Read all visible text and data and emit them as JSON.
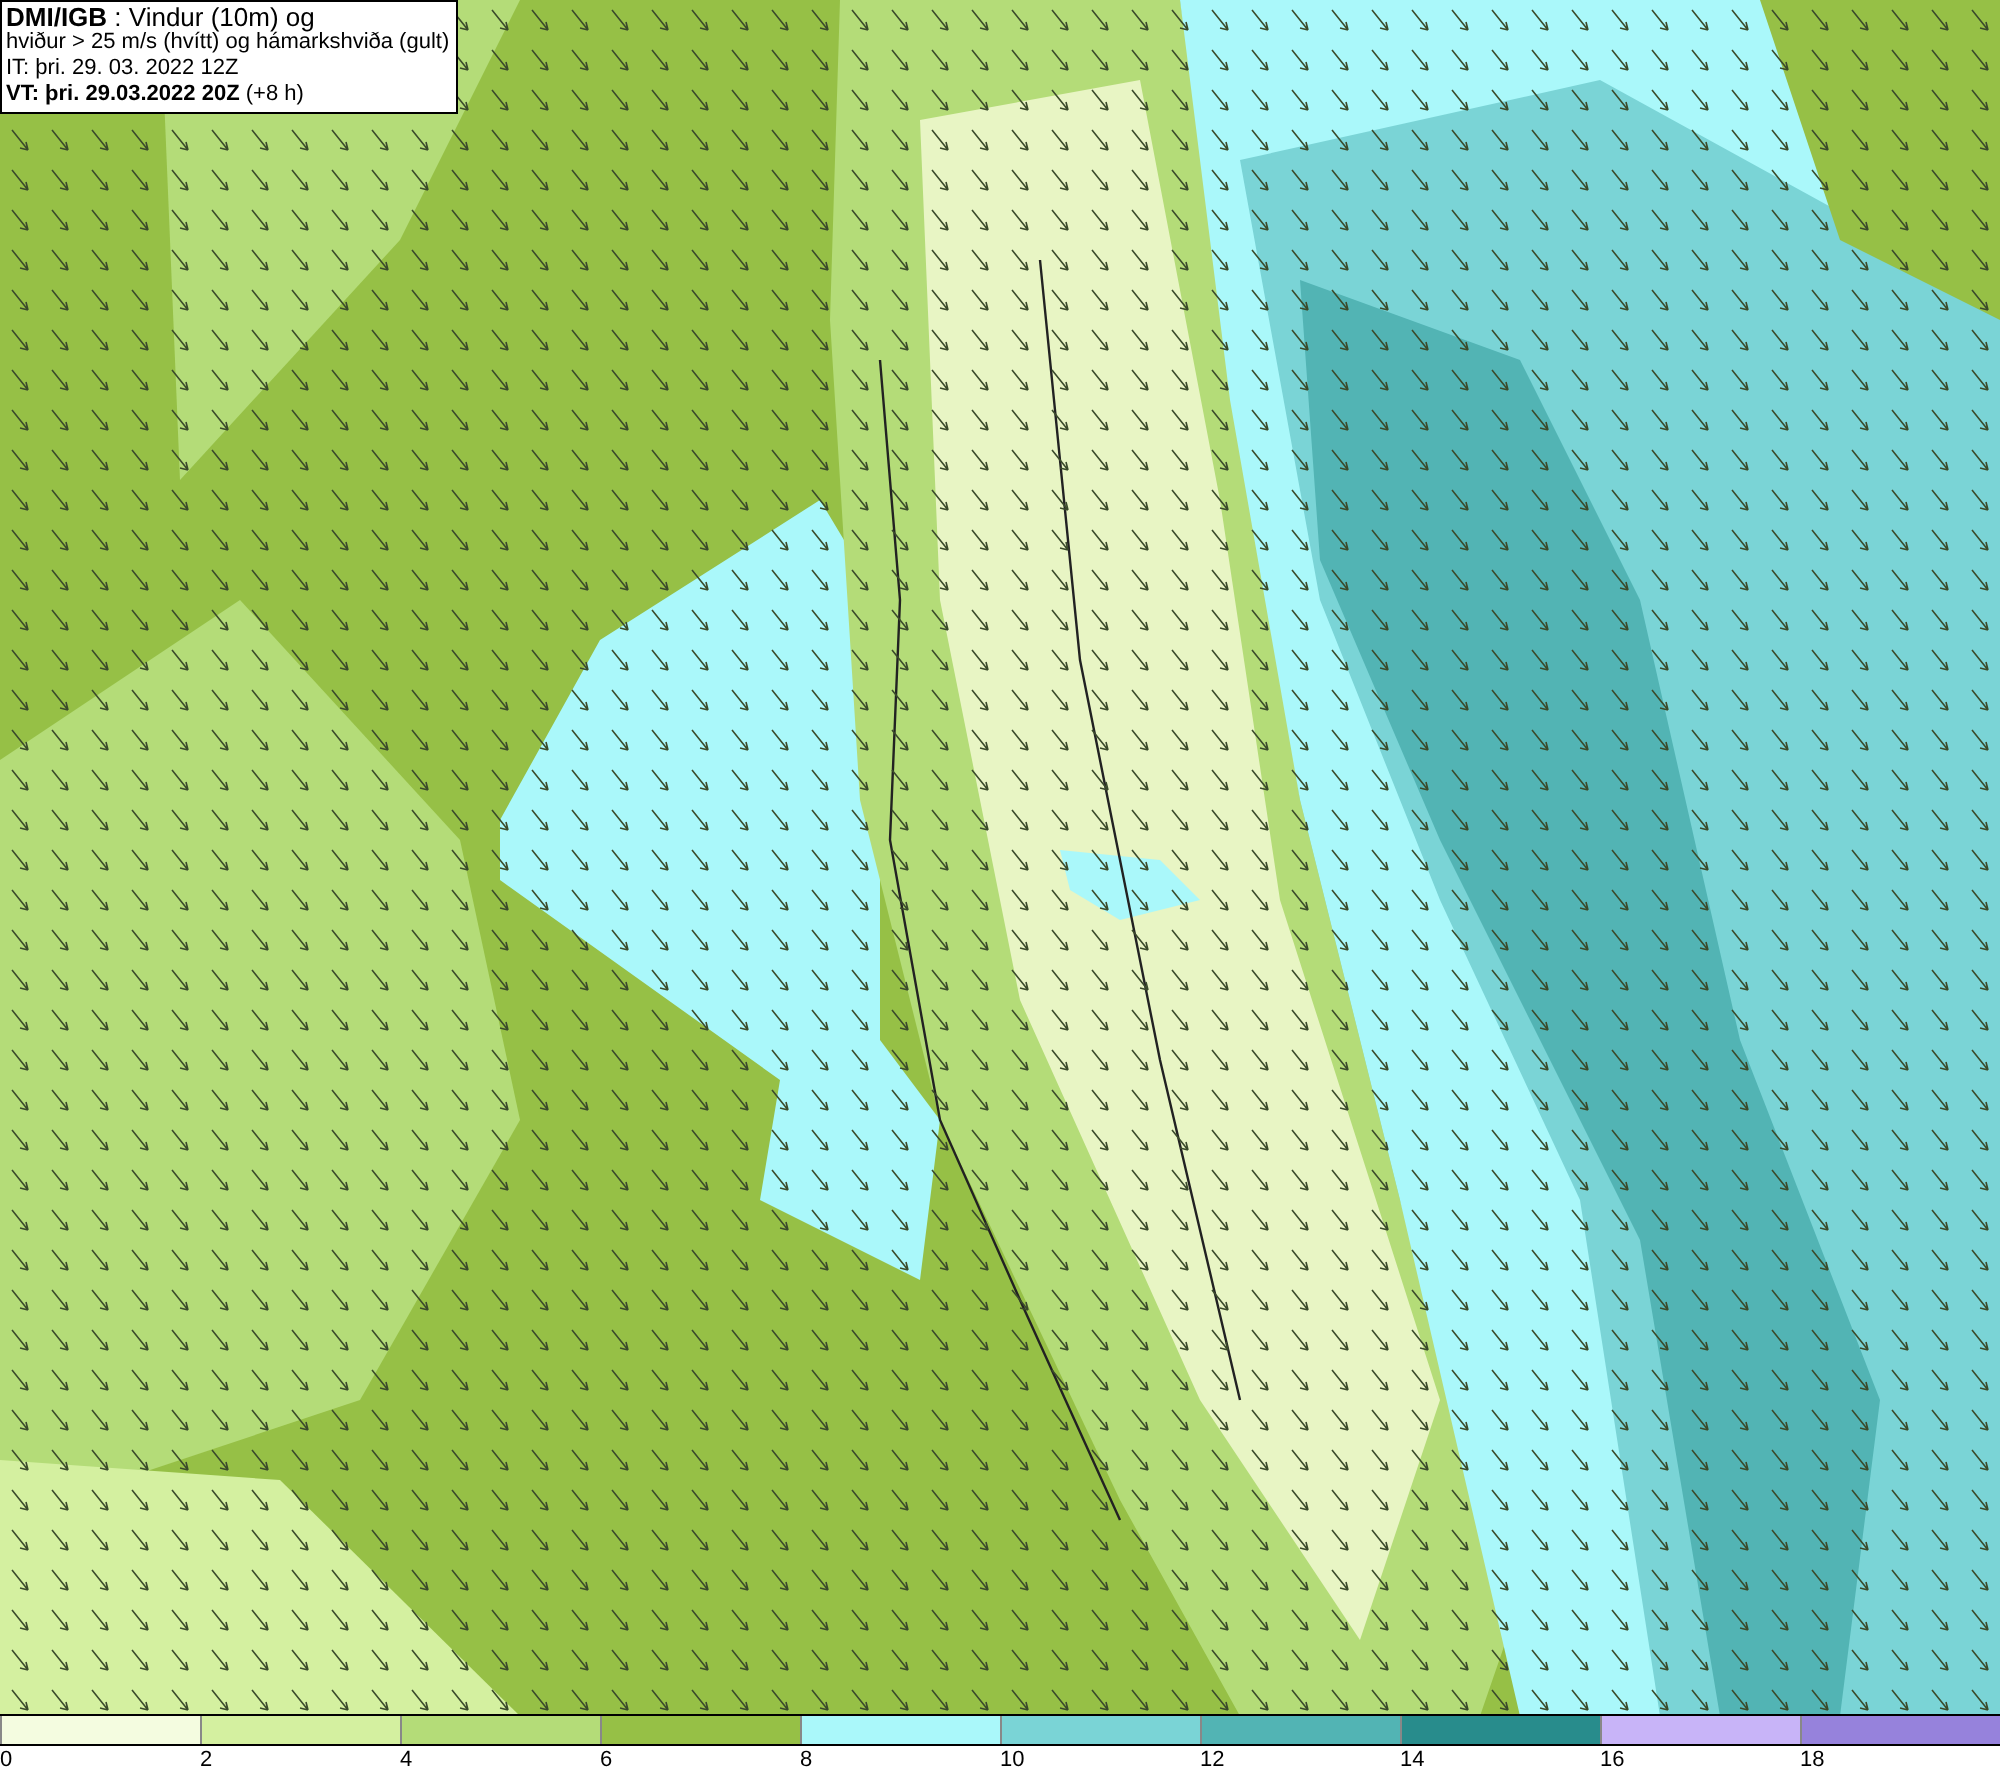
{
  "info": {
    "lines": [
      "**DMI/IGB** : Vindur (10m) og",
      "hviður > 25 m/s (hvítt) og hámarkshviða (gult)",
      "IT: þri. 29. 03. 2022 12Z",
      "**VT: þri. 29.03.2022 20Z** (+8 h)"
    ]
  },
  "legend": {
    "bins": [
      {
        "label": "0",
        "color": "#f4fce0"
      },
      {
        "label": "2",
        "color": "#d4f0a0"
      },
      {
        "label": "4",
        "color": "#b4dc78"
      },
      {
        "label": "6",
        "color": "#96c046"
      },
      {
        "label": "8",
        "color": "#aaf8fa"
      },
      {
        "label": "10",
        "color": "#7ad4d6"
      },
      {
        "label": "12",
        "color": "#52b4b4"
      },
      {
        "label": "14",
        "color": "#288c8c"
      },
      {
        "label": "16",
        "color": "#c8b4f8"
      },
      {
        "label": "18",
        "color": "#9682dc"
      }
    ]
  }
}
